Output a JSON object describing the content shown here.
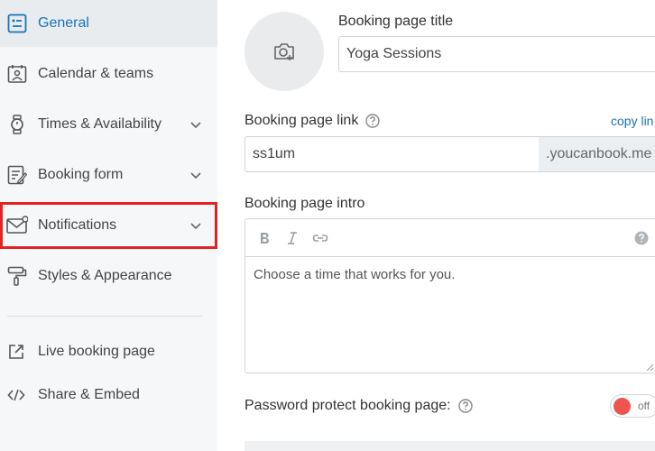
{
  "sidebar": {
    "items": [
      {
        "label": "General",
        "icon": "general-icon",
        "active": true,
        "expandable": false
      },
      {
        "label": "Calendar & teams",
        "icon": "calendar-team-icon",
        "active": false,
        "expandable": false
      },
      {
        "label": "Times & Availability",
        "icon": "watch-icon",
        "active": false,
        "expandable": true
      },
      {
        "label": "Booking form",
        "icon": "form-icon",
        "active": false,
        "expandable": true
      },
      {
        "label": "Notifications",
        "icon": "envelope-icon",
        "active": false,
        "expandable": true,
        "highlighted": true
      },
      {
        "label": "Styles & Appearance",
        "icon": "paint-roller-icon",
        "active": false,
        "expandable": false
      }
    ],
    "links": [
      {
        "label": "Live booking page",
        "icon": "external-link-icon"
      },
      {
        "label": "Share & Embed",
        "icon": "code-icon"
      }
    ]
  },
  "main": {
    "title_label": "Booking page title",
    "title_value": "Yoga Sessions",
    "link_label": "Booking page link",
    "copy_link": "copy lin",
    "link_value": "ss1um",
    "link_domain": ".youcanbook.me",
    "intro_label": "Booking page intro",
    "intro_text": "Choose a time that works for you.",
    "password_label": "Password protect booking page:",
    "password_toggle": "off"
  },
  "colors": {
    "accent": "#1a73b8",
    "highlight_border": "#e02424",
    "toggle_off": "#ef5350",
    "sidebar_bg": "#f5f7f9"
  }
}
